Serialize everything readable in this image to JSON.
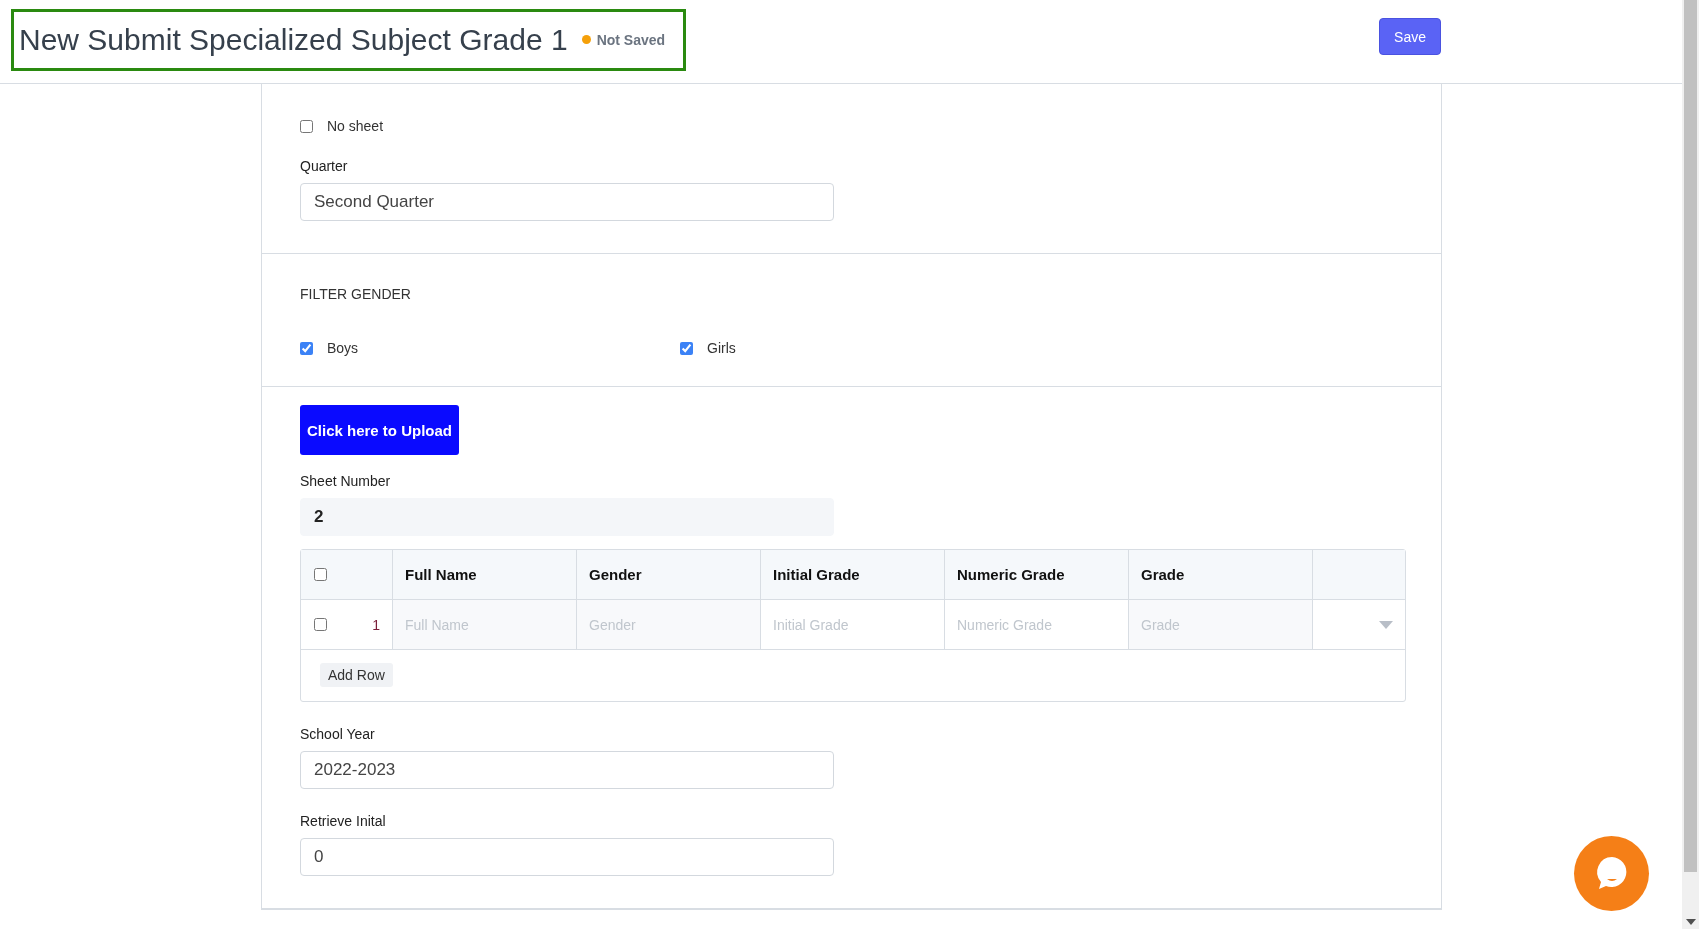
{
  "header": {
    "title": "New Submit Specialized Subject Grade 1",
    "status": "Not Saved",
    "save_button": "Save"
  },
  "no_sheet": {
    "label": "No sheet",
    "checked": false
  },
  "quarter": {
    "label": "Quarter",
    "value": "Second Quarter"
  },
  "filter_gender": {
    "title": "FILTER GENDER",
    "options": [
      {
        "label": "Boys",
        "checked": true
      },
      {
        "label": "Girls",
        "checked": true
      }
    ]
  },
  "upload_button": "Click here to Upload",
  "sheet_number": {
    "label": "Sheet Number",
    "value": "2"
  },
  "table": {
    "select_all": false,
    "columns": [
      "Full Name",
      "Gender",
      "Initial Grade",
      "Numeric Grade",
      "Grade"
    ],
    "rows": [
      {
        "checked": false,
        "index": "1",
        "placeholders": [
          "Full Name",
          "Gender",
          "Initial Grade",
          "Numeric Grade",
          "Grade"
        ]
      }
    ],
    "add_row": "Add Row"
  },
  "school_year": {
    "label": "School Year",
    "value": "2022-2023"
  },
  "retrieve_initial": {
    "label": "Retrieve Inital",
    "value": "0"
  }
}
